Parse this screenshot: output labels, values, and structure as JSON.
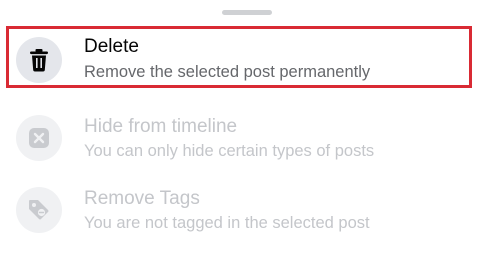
{
  "sheet": {
    "items": [
      {
        "icon": "trash-icon",
        "title": "Delete",
        "subtitle": "Remove the selected post permanently",
        "enabled": true,
        "highlighted": true
      },
      {
        "icon": "hide-x-icon",
        "title": "Hide from timeline",
        "subtitle": "You can only hide certain types of posts",
        "enabled": false,
        "highlighted": false
      },
      {
        "icon": "tag-icon",
        "title": "Remove Tags",
        "subtitle": "You are not tagged in the selected post",
        "enabled": false,
        "highlighted": false
      }
    ]
  },
  "colors": {
    "highlight_border": "#d92a34",
    "enabled_text": "#050505",
    "secondary_text": "#65676b",
    "disabled_text": "#c4c6ca"
  }
}
